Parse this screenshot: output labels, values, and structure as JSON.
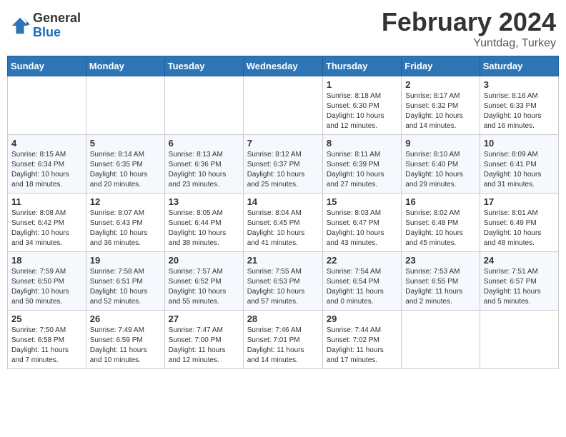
{
  "header": {
    "logo_general": "General",
    "logo_blue": "Blue",
    "title": "February 2024",
    "subtitle": "Yuntdag, Turkey"
  },
  "weekdays": [
    "Sunday",
    "Monday",
    "Tuesday",
    "Wednesday",
    "Thursday",
    "Friday",
    "Saturday"
  ],
  "weeks": [
    [
      {
        "day": "",
        "info": ""
      },
      {
        "day": "",
        "info": ""
      },
      {
        "day": "",
        "info": ""
      },
      {
        "day": "",
        "info": ""
      },
      {
        "day": "1",
        "info": "Sunrise: 8:18 AM\nSunset: 6:30 PM\nDaylight: 10 hours\nand 12 minutes."
      },
      {
        "day": "2",
        "info": "Sunrise: 8:17 AM\nSunset: 6:32 PM\nDaylight: 10 hours\nand 14 minutes."
      },
      {
        "day": "3",
        "info": "Sunrise: 8:16 AM\nSunset: 6:33 PM\nDaylight: 10 hours\nand 16 minutes."
      }
    ],
    [
      {
        "day": "4",
        "info": "Sunrise: 8:15 AM\nSunset: 6:34 PM\nDaylight: 10 hours\nand 18 minutes."
      },
      {
        "day": "5",
        "info": "Sunrise: 8:14 AM\nSunset: 6:35 PM\nDaylight: 10 hours\nand 20 minutes."
      },
      {
        "day": "6",
        "info": "Sunrise: 8:13 AM\nSunset: 6:36 PM\nDaylight: 10 hours\nand 23 minutes."
      },
      {
        "day": "7",
        "info": "Sunrise: 8:12 AM\nSunset: 6:37 PM\nDaylight: 10 hours\nand 25 minutes."
      },
      {
        "day": "8",
        "info": "Sunrise: 8:11 AM\nSunset: 6:39 PM\nDaylight: 10 hours\nand 27 minutes."
      },
      {
        "day": "9",
        "info": "Sunrise: 8:10 AM\nSunset: 6:40 PM\nDaylight: 10 hours\nand 29 minutes."
      },
      {
        "day": "10",
        "info": "Sunrise: 8:09 AM\nSunset: 6:41 PM\nDaylight: 10 hours\nand 31 minutes."
      }
    ],
    [
      {
        "day": "11",
        "info": "Sunrise: 8:08 AM\nSunset: 6:42 PM\nDaylight: 10 hours\nand 34 minutes."
      },
      {
        "day": "12",
        "info": "Sunrise: 8:07 AM\nSunset: 6:43 PM\nDaylight: 10 hours\nand 36 minutes."
      },
      {
        "day": "13",
        "info": "Sunrise: 8:05 AM\nSunset: 6:44 PM\nDaylight: 10 hours\nand 38 minutes."
      },
      {
        "day": "14",
        "info": "Sunrise: 8:04 AM\nSunset: 6:45 PM\nDaylight: 10 hours\nand 41 minutes."
      },
      {
        "day": "15",
        "info": "Sunrise: 8:03 AM\nSunset: 6:47 PM\nDaylight: 10 hours\nand 43 minutes."
      },
      {
        "day": "16",
        "info": "Sunrise: 8:02 AM\nSunset: 6:48 PM\nDaylight: 10 hours\nand 45 minutes."
      },
      {
        "day": "17",
        "info": "Sunrise: 8:01 AM\nSunset: 6:49 PM\nDaylight: 10 hours\nand 48 minutes."
      }
    ],
    [
      {
        "day": "18",
        "info": "Sunrise: 7:59 AM\nSunset: 6:50 PM\nDaylight: 10 hours\nand 50 minutes."
      },
      {
        "day": "19",
        "info": "Sunrise: 7:58 AM\nSunset: 6:51 PM\nDaylight: 10 hours\nand 52 minutes."
      },
      {
        "day": "20",
        "info": "Sunrise: 7:57 AM\nSunset: 6:52 PM\nDaylight: 10 hours\nand 55 minutes."
      },
      {
        "day": "21",
        "info": "Sunrise: 7:55 AM\nSunset: 6:53 PM\nDaylight: 10 hours\nand 57 minutes."
      },
      {
        "day": "22",
        "info": "Sunrise: 7:54 AM\nSunset: 6:54 PM\nDaylight: 11 hours\nand 0 minutes."
      },
      {
        "day": "23",
        "info": "Sunrise: 7:53 AM\nSunset: 6:55 PM\nDaylight: 11 hours\nand 2 minutes."
      },
      {
        "day": "24",
        "info": "Sunrise: 7:51 AM\nSunset: 6:57 PM\nDaylight: 11 hours\nand 5 minutes."
      }
    ],
    [
      {
        "day": "25",
        "info": "Sunrise: 7:50 AM\nSunset: 6:58 PM\nDaylight: 11 hours\nand 7 minutes."
      },
      {
        "day": "26",
        "info": "Sunrise: 7:49 AM\nSunset: 6:59 PM\nDaylight: 11 hours\nand 10 minutes."
      },
      {
        "day": "27",
        "info": "Sunrise: 7:47 AM\nSunset: 7:00 PM\nDaylight: 11 hours\nand 12 minutes."
      },
      {
        "day": "28",
        "info": "Sunrise: 7:46 AM\nSunset: 7:01 PM\nDaylight: 11 hours\nand 14 minutes."
      },
      {
        "day": "29",
        "info": "Sunrise: 7:44 AM\nSunset: 7:02 PM\nDaylight: 11 hours\nand 17 minutes."
      },
      {
        "day": "",
        "info": ""
      },
      {
        "day": "",
        "info": ""
      }
    ]
  ]
}
